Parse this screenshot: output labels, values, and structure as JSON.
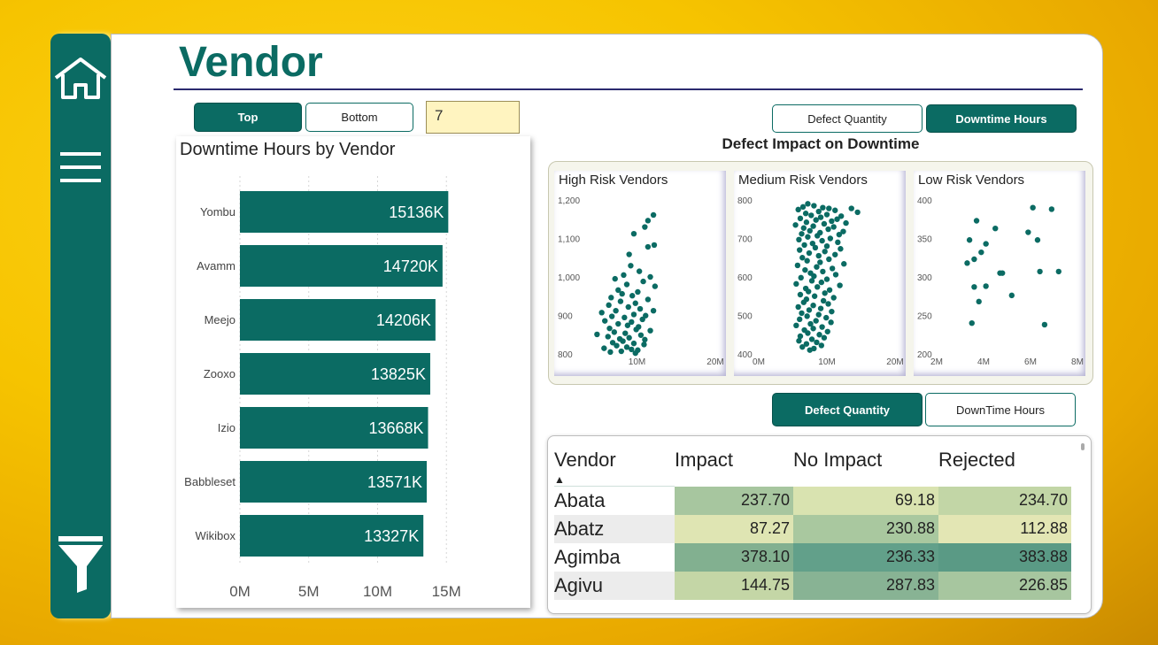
{
  "page": {
    "title": "Vendor"
  },
  "sidebar": {
    "icons": [
      "home-icon",
      "menu-icon",
      "filter-icon"
    ]
  },
  "controls": {
    "top_label": "Top",
    "bottom_label": "Bottom",
    "n_value": "7",
    "metric_toggle": {
      "defect_label": "Defect Quantity",
      "downtime_label": "Downtime Hours",
      "active": "Downtime Hours"
    },
    "table_toggle": {
      "defect_label": "Defect Quantity",
      "downtime_label": "DownTime Hours",
      "active": "Defect Quantity"
    }
  },
  "colors": {
    "brand": "#0b6b63",
    "accent_bg": "#f6c400",
    "input_bg": "#fff4c0"
  },
  "scatter_section_title": "Defect Impact on Downtime",
  "chart_data": [
    {
      "type": "bar",
      "orientation": "horizontal",
      "title": "Downtime Hours by Vendor",
      "categories": [
        "Yombu",
        "Avamm",
        "Meejo",
        "Zooxo",
        "Izio",
        "Babbleset",
        "Wikibox"
      ],
      "values": [
        15136,
        14720,
        14206,
        13825,
        13668,
        13571,
        13327
      ],
      "value_labels": [
        "15136K",
        "14720K",
        "14206K",
        "13825K",
        "13668K",
        "13571K",
        "13327K"
      ],
      "xticks": [
        "0M",
        "5M",
        "10M",
        "15M"
      ],
      "xlim": [
        0,
        15.5
      ],
      "unit": "M",
      "grid": true
    },
    {
      "type": "scatter",
      "title": "High Risk Vendors",
      "xticks": [
        "10M",
        "20M"
      ],
      "yticks": [
        "800",
        "900",
        "1,000",
        "1,100",
        "1,200"
      ],
      "xlim": [
        0,
        20
      ],
      "ylim": [
        790,
        1200
      ],
      "points": [
        [
          12.1,
          1160
        ],
        [
          11.4,
          1145
        ],
        [
          11.0,
          1128
        ],
        [
          9.6,
          1110
        ],
        [
          12.2,
          1080
        ],
        [
          11.4,
          1075
        ],
        [
          9.0,
          1055
        ],
        [
          9.2,
          1025
        ],
        [
          10.3,
          1010
        ],
        [
          8.3,
          1000
        ],
        [
          11.7,
          995
        ],
        [
          7.2,
          990
        ],
        [
          10.8,
          983
        ],
        [
          8.7,
          975
        ],
        [
          12.3,
          970
        ],
        [
          7.6,
          960
        ],
        [
          10.1,
          955
        ],
        [
          8.1,
          950
        ],
        [
          9.4,
          945
        ],
        [
          6.7,
          940
        ],
        [
          11.4,
          935
        ],
        [
          7.9,
          930
        ],
        [
          9.8,
          925
        ],
        [
          6.4,
          920
        ],
        [
          8.9,
          915
        ],
        [
          10.4,
          910
        ],
        [
          12.1,
          905
        ],
        [
          7.3,
          905
        ],
        [
          5.5,
          900
        ],
        [
          9.6,
          895
        ],
        [
          11.1,
          892
        ],
        [
          6.8,
          890
        ],
        [
          8.4,
          887
        ],
        [
          10.7,
          882
        ],
        [
          5.9,
          878
        ],
        [
          9.3,
          875
        ],
        [
          7.6,
          870
        ],
        [
          8.8,
          866
        ],
        [
          10.2,
          862
        ],
        [
          6.5,
          858
        ],
        [
          9.9,
          855
        ],
        [
          11.7,
          852
        ],
        [
          7.1,
          848
        ],
        [
          8.5,
          845
        ],
        [
          4.9,
          842
        ],
        [
          10.5,
          840
        ],
        [
          6.3,
          836
        ],
        [
          9.0,
          833
        ],
        [
          7.8,
          830
        ],
        [
          11.0,
          828
        ],
        [
          8.2,
          824
        ],
        [
          6.9,
          820
        ],
        [
          9.6,
          818
        ],
        [
          10.9,
          815
        ],
        [
          7.4,
          812
        ],
        [
          8.7,
          808
        ],
        [
          5.8,
          805
        ],
        [
          9.3,
          802
        ],
        [
          10.1,
          800
        ],
        [
          8.0,
          797
        ],
        [
          6.6,
          795
        ],
        [
          9.8,
          792
        ]
      ]
    },
    {
      "type": "scatter",
      "title": "Medium Risk Vendors",
      "xticks": [
        "0M",
        "10M",
        "20M"
      ],
      "yticks": [
        "400",
        "500",
        "600",
        "700",
        "800"
      ],
      "xlim": [
        0,
        20
      ],
      "ylim": [
        400,
        800
      ],
      "points": [
        [
          7.2,
          790
        ],
        [
          8.1,
          785
        ],
        [
          6.5,
          782
        ],
        [
          9.4,
          780
        ],
        [
          10.3,
          778
        ],
        [
          13.6,
          778
        ],
        [
          5.8,
          775
        ],
        [
          11.2,
          773
        ],
        [
          8.8,
          770
        ],
        [
          14.5,
          768
        ],
        [
          6.9,
          765
        ],
        [
          10.0,
          762
        ],
        [
          7.7,
          760
        ],
        [
          12.1,
          758
        ],
        [
          9.1,
          755
        ],
        [
          6.1,
          752
        ],
        [
          11.5,
          750
        ],
        [
          8.4,
          748
        ],
        [
          10.7,
          745
        ],
        [
          7.0,
          742
        ],
        [
          12.8,
          740
        ],
        [
          9.6,
          738
        ],
        [
          5.4,
          735
        ],
        [
          8.0,
          732
        ],
        [
          11.0,
          730
        ],
        [
          6.6,
          727
        ],
        [
          10.2,
          724
        ],
        [
          7.5,
          720
        ],
        [
          12.4,
          718
        ],
        [
          9.0,
          715
        ],
        [
          6.3,
          712
        ],
        [
          11.8,
          710
        ],
        [
          8.6,
          707
        ],
        [
          7.2,
          704
        ],
        [
          10.5,
          700
        ],
        [
          5.9,
          697
        ],
        [
          9.3,
          694
        ],
        [
          11.6,
          690
        ],
        [
          7.9,
          687
        ],
        [
          6.7,
          683
        ],
        [
          10.0,
          680
        ],
        [
          8.3,
          676
        ],
        [
          12.0,
          673
        ],
        [
          6.0,
          670
        ],
        [
          9.7,
          666
        ],
        [
          7.4,
          662
        ],
        [
          11.2,
          658
        ],
        [
          8.8,
          655
        ],
        [
          6.4,
          650
        ],
        [
          10.3,
          646
        ],
        [
          7.1,
          642
        ],
        [
          9.0,
          638
        ],
        [
          12.5,
          634
        ],
        [
          5.7,
          630
        ],
        [
          8.5,
          626
        ],
        [
          10.8,
          622
        ],
        [
          6.8,
          618
        ],
        [
          9.4,
          614
        ],
        [
          7.6,
          610
        ],
        [
          11.3,
          606
        ],
        [
          8.1,
          602
        ],
        [
          6.2,
          598
        ],
        [
          10.0,
          594
        ],
        [
          7.8,
          590
        ],
        [
          9.2,
          586
        ],
        [
          5.5,
          582
        ],
        [
          11.9,
          578
        ],
        [
          8.6,
          574
        ],
        [
          6.9,
          570
        ],
        [
          10.4,
          566
        ],
        [
          7.3,
          562
        ],
        [
          9.7,
          558
        ],
        [
          6.1,
          554
        ],
        [
          8.2,
          550
        ],
        [
          11.0,
          546
        ],
        [
          7.0,
          542
        ],
        [
          9.5,
          538
        ],
        [
          6.6,
          534
        ],
        [
          10.2,
          530
        ],
        [
          8.0,
          526
        ],
        [
          5.8,
          522
        ],
        [
          9.1,
          518
        ],
        [
          7.4,
          514
        ],
        [
          10.7,
          510
        ],
        [
          6.3,
          506
        ],
        [
          8.8,
          502
        ],
        [
          7.1,
          498
        ],
        [
          9.9,
          494
        ],
        [
          6.0,
          490
        ],
        [
          8.4,
          486
        ],
        [
          10.6,
          482
        ],
        [
          7.6,
          478
        ],
        [
          5.5,
          474
        ],
        [
          9.3,
          470
        ],
        [
          8.0,
          466
        ],
        [
          6.7,
          462
        ],
        [
          10.1,
          458
        ],
        [
          7.2,
          454
        ],
        [
          8.9,
          450
        ],
        [
          6.1,
          446
        ],
        [
          9.6,
          442
        ],
        [
          7.8,
          438
        ],
        [
          5.9,
          434
        ],
        [
          8.5,
          430
        ],
        [
          7.0,
          426
        ],
        [
          9.2,
          422
        ],
        [
          6.4,
          418
        ],
        [
          8.1,
          414
        ],
        [
          7.5,
          410
        ]
      ]
    },
    {
      "type": "scatter",
      "title": "Low Risk Vendors",
      "xticks": [
        "2M",
        "4M",
        "6M",
        "8M"
      ],
      "yticks": [
        "200",
        "250",
        "300",
        "350",
        "400"
      ],
      "xlim": [
        2,
        8
      ],
      "ylim": [
        200,
        400
      ],
      "points": [
        [
          6.1,
          390
        ],
        [
          6.9,
          388
        ],
        [
          3.7,
          373
        ],
        [
          4.5,
          363
        ],
        [
          5.9,
          358
        ],
        [
          3.4,
          348
        ],
        [
          6.3,
          348
        ],
        [
          4.1,
          343
        ],
        [
          3.9,
          332
        ],
        [
          3.6,
          323
        ],
        [
          3.3,
          318
        ],
        [
          6.4,
          307
        ],
        [
          7.2,
          307
        ],
        [
          4.7,
          305
        ],
        [
          4.8,
          305
        ],
        [
          3.6,
          287
        ],
        [
          4.1,
          288
        ],
        [
          5.2,
          276
        ],
        [
          3.8,
          268
        ],
        [
          3.5,
          240
        ],
        [
          6.6,
          238
        ]
      ]
    }
  ],
  "table": {
    "columns": [
      "Vendor",
      "Impact",
      "No Impact",
      "Rejected"
    ],
    "rows": [
      {
        "vendor": "Abata",
        "impact": "237.70",
        "no_impact": "69.18",
        "rejected": "234.70"
      },
      {
        "vendor": "Abatz",
        "impact": "87.27",
        "no_impact": "230.88",
        "rejected": "112.88"
      },
      {
        "vendor": "Agimba",
        "impact": "378.10",
        "no_impact": "236.33",
        "rejected": "383.88"
      },
      {
        "vendor": "Agivu",
        "impact": "144.75",
        "no_impact": "287.83",
        "rejected": "226.85"
      }
    ],
    "cell_colors": [
      [
        "#a7c69f",
        "#d9e3b0",
        "#c2d6a6"
      ],
      [
        "#dfe5b3",
        "#a9c89f",
        "#e3e6b4"
      ],
      [
        "#82b090",
        "#62a08a",
        "#5a9a85"
      ],
      [
        "#c4d6a6",
        "#88b394",
        "#a7c69f"
      ]
    ]
  }
}
